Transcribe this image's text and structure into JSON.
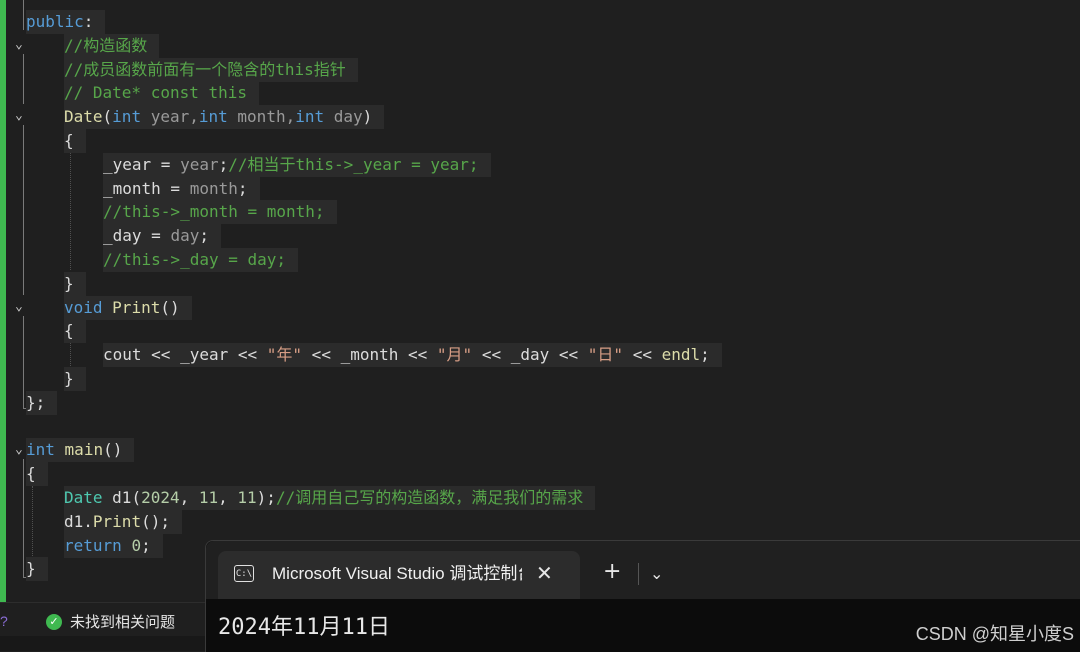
{
  "editor": {
    "lines": [
      {
        "tokens": [
          {
            "t": "public",
            "c": "kw"
          },
          {
            "t": ":",
            "c": "pl"
          }
        ],
        "indent": 0
      },
      {
        "tokens": [
          {
            "t": "//构造函数",
            "c": "cm"
          }
        ],
        "indent": 1
      },
      {
        "tokens": [
          {
            "t": "//成员函数前面有一个隐含的this指针",
            "c": "cm"
          }
        ],
        "indent": 1
      },
      {
        "tokens": [
          {
            "t": "// Date* const this",
            "c": "cm"
          }
        ],
        "indent": 1
      },
      {
        "tokens": [
          {
            "t": "Date",
            "c": "fn"
          },
          {
            "t": "(",
            "c": "pl"
          },
          {
            "t": "int",
            "c": "kw"
          },
          {
            "t": " year,",
            "c": "pa"
          },
          {
            "t": "int",
            "c": "kw"
          },
          {
            "t": " month,",
            "c": "pa"
          },
          {
            "t": "int",
            "c": "kw"
          },
          {
            "t": " day",
            "c": "pa"
          },
          {
            "t": ")",
            "c": "pl"
          }
        ],
        "indent": 1
      },
      {
        "tokens": [
          {
            "t": "{",
            "c": "pl"
          }
        ],
        "indent": 1
      },
      {
        "tokens": [
          {
            "t": "_year",
            "c": "id"
          },
          {
            "t": " = ",
            "c": "pl"
          },
          {
            "t": "year",
            "c": "pa"
          },
          {
            "t": ";",
            "c": "pl"
          },
          {
            "t": "//相当于this->_year = year;",
            "c": "cm"
          }
        ],
        "indent": 2
      },
      {
        "tokens": [
          {
            "t": "_month",
            "c": "id"
          },
          {
            "t": " = ",
            "c": "pl"
          },
          {
            "t": "month",
            "c": "pa"
          },
          {
            "t": ";",
            "c": "pl"
          }
        ],
        "indent": 2
      },
      {
        "tokens": [
          {
            "t": "//this->_month = month;",
            "c": "cm"
          }
        ],
        "indent": 2
      },
      {
        "tokens": [
          {
            "t": "_day",
            "c": "id"
          },
          {
            "t": " = ",
            "c": "pl"
          },
          {
            "t": "day",
            "c": "pa"
          },
          {
            "t": ";",
            "c": "pl"
          }
        ],
        "indent": 2
      },
      {
        "tokens": [
          {
            "t": "//this->_day = day;",
            "c": "cm"
          }
        ],
        "indent": 2
      },
      {
        "tokens": [
          {
            "t": "}",
            "c": "pl"
          }
        ],
        "indent": 1
      },
      {
        "tokens": [
          {
            "t": "void",
            "c": "kw"
          },
          {
            "t": " ",
            "c": "pl"
          },
          {
            "t": "Print",
            "c": "fn"
          },
          {
            "t": "()",
            "c": "pl"
          }
        ],
        "indent": 1
      },
      {
        "tokens": [
          {
            "t": "{",
            "c": "pl"
          }
        ],
        "indent": 1
      },
      {
        "tokens": [
          {
            "t": "cout",
            "c": "id"
          },
          {
            "t": " << ",
            "c": "pl"
          },
          {
            "t": "_year",
            "c": "id"
          },
          {
            "t": " << ",
            "c": "pl"
          },
          {
            "t": "\"年\"",
            "c": "st"
          },
          {
            "t": " << ",
            "c": "pl"
          },
          {
            "t": "_month",
            "c": "id"
          },
          {
            "t": " << ",
            "c": "pl"
          },
          {
            "t": "\"月\"",
            "c": "st"
          },
          {
            "t": " << ",
            "c": "pl"
          },
          {
            "t": "_day",
            "c": "id"
          },
          {
            "t": " << ",
            "c": "pl"
          },
          {
            "t": "\"日\"",
            "c": "st"
          },
          {
            "t": " << ",
            "c": "pl"
          },
          {
            "t": "endl",
            "c": "fn"
          },
          {
            "t": ";",
            "c": "pl"
          }
        ],
        "indent": 2
      },
      {
        "tokens": [
          {
            "t": "}",
            "c": "pl"
          }
        ],
        "indent": 1
      },
      {
        "tokens": [
          {
            "t": "};",
            "c": "pl"
          }
        ],
        "indent": 0
      },
      {
        "tokens": [],
        "indent": 0
      },
      {
        "tokens": [
          {
            "t": "int",
            "c": "kw"
          },
          {
            "t": " ",
            "c": "pl"
          },
          {
            "t": "main",
            "c": "fn"
          },
          {
            "t": "()",
            "c": "pl"
          }
        ],
        "indent": 0
      },
      {
        "tokens": [
          {
            "t": "{",
            "c": "pl"
          }
        ],
        "indent": 0
      },
      {
        "tokens": [
          {
            "t": "Date",
            "c": "ty"
          },
          {
            "t": " ",
            "c": "pl"
          },
          {
            "t": "d1",
            "c": "id"
          },
          {
            "t": "(",
            "c": "pl"
          },
          {
            "t": "2024",
            "c": "nm"
          },
          {
            "t": ", ",
            "c": "pl"
          },
          {
            "t": "11",
            "c": "nm"
          },
          {
            "t": ", ",
            "c": "pl"
          },
          {
            "t": "11",
            "c": "nm"
          },
          {
            "t": ");",
            "c": "pl"
          },
          {
            "t": "//调用自己写的构造函数，满足我们的需求",
            "c": "cm"
          }
        ],
        "indent": 1
      },
      {
        "tokens": [
          {
            "t": "d1",
            "c": "id"
          },
          {
            "t": ".",
            "c": "pl"
          },
          {
            "t": "Print",
            "c": "fn"
          },
          {
            "t": "();",
            "c": "pl"
          }
        ],
        "indent": 1
      },
      {
        "tokens": [
          {
            "t": "return",
            "c": "kw"
          },
          {
            "t": " ",
            "c": "pl"
          },
          {
            "t": "0",
            "c": "nm"
          },
          {
            "t": ";",
            "c": "pl"
          }
        ],
        "indent": 1
      },
      {
        "tokens": [
          {
            "t": "}",
            "c": "pl"
          }
        ],
        "indent": 0
      }
    ]
  },
  "status": {
    "issues_text": "未找到相关问题",
    "ok_icon": "check-circle-icon"
  },
  "terminal": {
    "tab_title": "Microsoft Visual Studio 调试控制台",
    "tab_icon": "C:\\",
    "close_glyph": "✕",
    "new_tab_glyph": "+",
    "dropdown_glyph": "⌄",
    "output": "2024年11月11日"
  },
  "watermark": "CSDN @知星小度S",
  "colors": {
    "keyword": "#569cd6",
    "comment": "#57a64a",
    "function": "#dcdcaa",
    "string": "#d69d85",
    "number": "#b5cea8",
    "gutter_accent": "#3fb950"
  }
}
